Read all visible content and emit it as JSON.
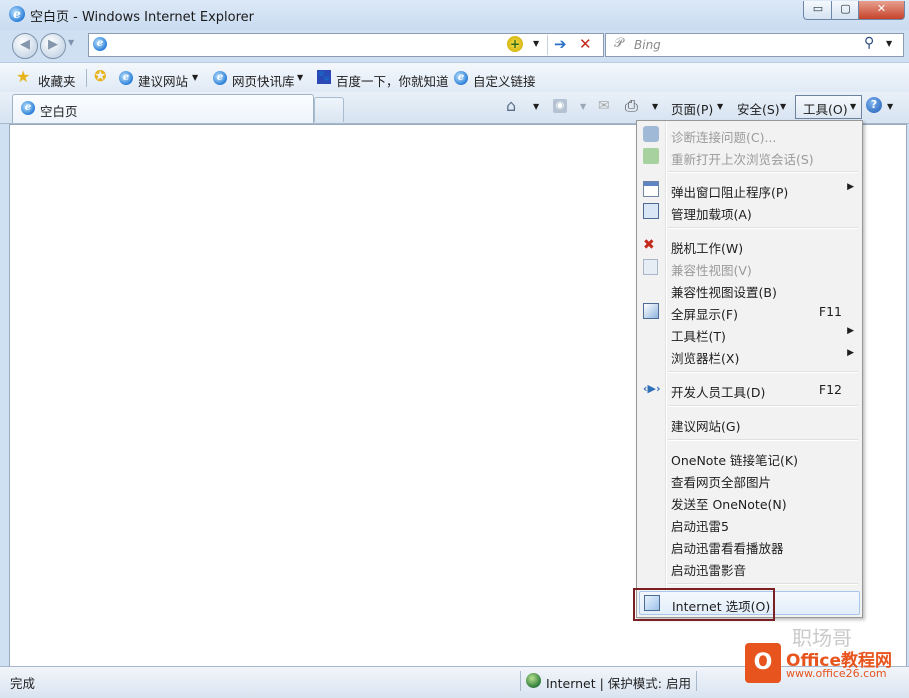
{
  "window": {
    "title": "空白页 - Windows Internet Explorer",
    "minimize_glyph": "▭",
    "maximize_glyph": "▢",
    "close_glyph": "✕"
  },
  "nav": {
    "address_value": "",
    "search_placeholder": "Bing",
    "back_icon": "back-arrow-icon",
    "forward_icon": "forward-arrow-icon"
  },
  "favorites_bar": {
    "favorites_label": "收藏夹",
    "items": [
      {
        "label": "建议网站"
      },
      {
        "label": "网页快讯库"
      },
      {
        "label": "百度一下，你就知道"
      },
      {
        "label": "自定义链接"
      }
    ]
  },
  "tabs": {
    "active_label": "空白页"
  },
  "command_bar": {
    "page_label": "页面(P)",
    "safety_label": "安全(S)",
    "tools_label": "工具(O)",
    "help_glyph": "?"
  },
  "tools_menu": {
    "items": [
      {
        "label": "诊断连接问题(C)...",
        "enabled": false,
        "icon": "diagnose-icon"
      },
      {
        "label": "重新打开上次浏览会话(S)",
        "enabled": false,
        "icon": "reopen-session-icon"
      },
      {
        "label": "弹出窗口阻止程序(P)",
        "enabled": true,
        "submenu": true,
        "icon": "popup-blocker-icon"
      },
      {
        "label": "管理加载项(A)",
        "enabled": true,
        "icon": "addons-icon"
      },
      {
        "label": "脱机工作(W)",
        "enabled": true,
        "icon": "offline-icon"
      },
      {
        "label": "兼容性视图(V)",
        "enabled": false,
        "icon": "compat-view-icon"
      },
      {
        "label": "兼容性视图设置(B)",
        "enabled": true
      },
      {
        "label": "全屏显示(F)",
        "enabled": true,
        "shortcut": "F11",
        "icon": "fullscreen-icon"
      },
      {
        "label": "工具栏(T)",
        "enabled": true,
        "submenu": true
      },
      {
        "label": "浏览器栏(X)",
        "enabled": true,
        "submenu": true
      },
      {
        "label": "开发人员工具(D)",
        "enabled": true,
        "shortcut": "F12",
        "icon": "developer-tools-icon"
      },
      {
        "label": "建议网站(G)",
        "enabled": true
      },
      {
        "label": "OneNote 链接笔记(K)",
        "enabled": true
      },
      {
        "label": "查看网页全部图片",
        "enabled": true
      },
      {
        "label": "发送至 OneNote(N)",
        "enabled": true
      },
      {
        "label": "启动迅雷5",
        "enabled": true
      },
      {
        "label": "启动迅雷看看播放器",
        "enabled": true
      },
      {
        "label": "启动迅雷影音",
        "enabled": true
      },
      {
        "label": "Internet 选项(O)",
        "enabled": true,
        "highlighted": true,
        "icon": "internet-options-icon"
      }
    ]
  },
  "status_bar": {
    "status_text": "完成",
    "zone_text": "Internet | 保护模式: 启用"
  },
  "watermark": {
    "wechat_text": "职场哥",
    "brand": "Office教程网",
    "url": "www.office26.com"
  },
  "colors": {
    "highlight_frame": "#7b1f22",
    "brand_orange": "#e8541e"
  }
}
